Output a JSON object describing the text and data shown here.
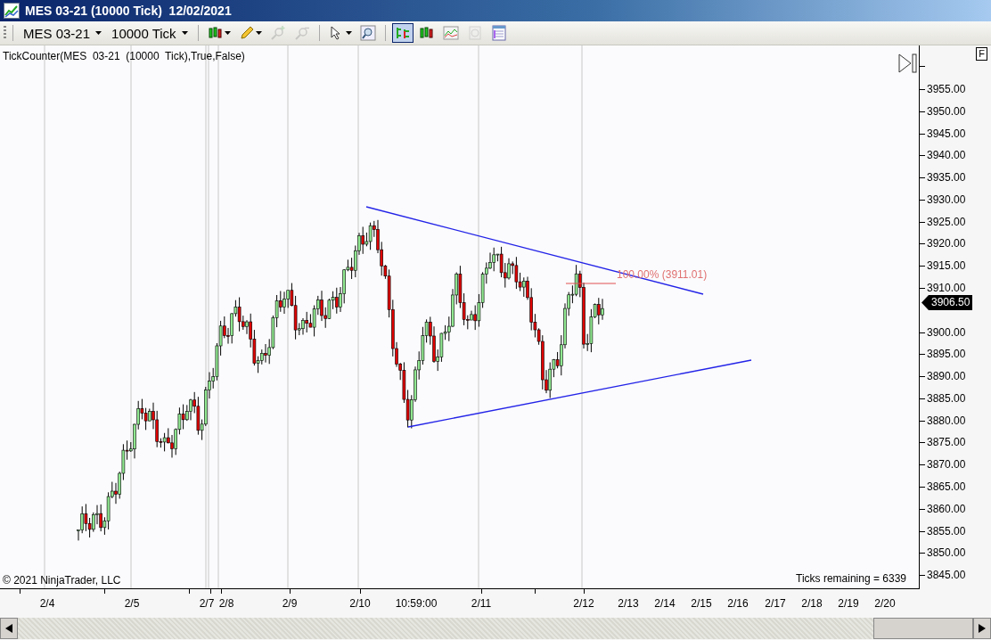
{
  "window": {
    "title": "MES 03-21 (10000 Tick)  12/02/2021"
  },
  "toolbar": {
    "instrument": "MES 03-21",
    "period": "10000 Tick",
    "tools": [
      {
        "kind": "candles",
        "menu": true,
        "disabled": false
      },
      {
        "kind": "pencil",
        "menu": true,
        "disabled": false
      },
      {
        "kind": "zoom-in",
        "menu": false,
        "disabled": true
      },
      {
        "kind": "zoom-out",
        "menu": false,
        "disabled": true
      },
      {
        "kind": "cursor",
        "menu": true,
        "disabled": false
      },
      {
        "kind": "magnifier",
        "menu": false,
        "disabled": false
      }
    ],
    "view_buttons": [
      {
        "kind": "bars",
        "selected": true,
        "disabled": false
      },
      {
        "kind": "candles",
        "selected": false,
        "disabled": false
      },
      {
        "kind": "line",
        "selected": false,
        "disabled": false
      },
      {
        "kind": "dollar",
        "selected": false,
        "disabled": true
      },
      {
        "kind": "table",
        "selected": false,
        "disabled": false
      }
    ]
  },
  "chart": {
    "indicator_label": "TickCounter(MES  03-21  (10000  Tick),True,False)",
    "fib_label": "100.00% (3911.01)",
    "copyright": "© 2021 NinjaTrader, LLC",
    "ticks_remaining": "Ticks remaining = 6339",
    "axis_button": "F",
    "price_marker": "3906.50",
    "y_labels": [
      "3955.00",
      "3950.00",
      "3945.00",
      "3940.00",
      "3935.00",
      "3930.00",
      "3925.00",
      "3920.00",
      "3915.00",
      "3910.00",
      "3900.00",
      "3895.00",
      "3890.00",
      "3885.00",
      "3880.00",
      "3875.00",
      "3870.00",
      "3865.00",
      "3860.00",
      "3855.00",
      "3850.00",
      "3845.00"
    ],
    "x_labels": [
      "2/4",
      "2/5",
      "2/7",
      "2/8",
      "2/9",
      "2/10",
      "10:59:00",
      "2/11",
      "2/12",
      "2/13",
      "2/14",
      "2/15",
      "2/16",
      "2/17",
      "2/18",
      "2/19",
      "2/20"
    ]
  }
}
